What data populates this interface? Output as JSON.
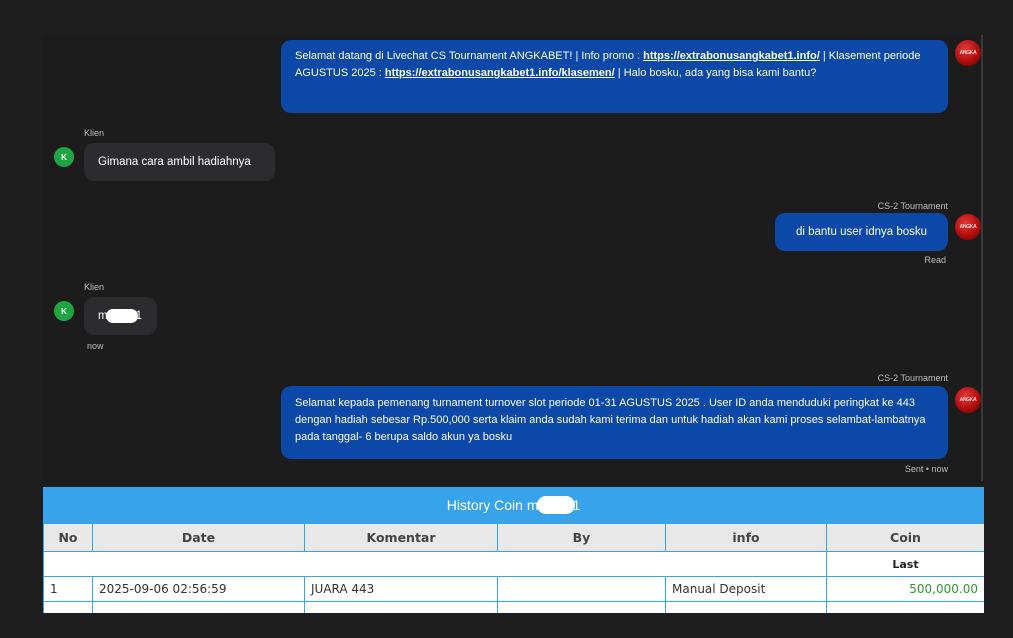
{
  "messages": {
    "m1": {
      "p1": "Selamat datang di Livechat CS Tournament ANGKABET! | Info promo : ",
      "link1": "https://extrabonusangkabet1.info/",
      "p2": " | Klasement periode AGUSTUS 2025 : ",
      "link2": "https://extrabonusangkabet1.info/klasemen/",
      "p3": " | Halo bosku, ada yang bisa kami bantu?"
    },
    "m2": {
      "sender": "Klien",
      "avatar": "K",
      "text": "Gimana cara ambil hadiahnya"
    },
    "m3": {
      "sender": "CS-2 Tournament",
      "text": "di bantu user idnya bosku",
      "status": "Read"
    },
    "m4": {
      "sender": "Klien",
      "avatar": "K",
      "text_start": "m",
      "text_end": "1",
      "time": "now"
    },
    "m5": {
      "sender": "CS-2 Tournament",
      "text": "Selamat kepada pemenang turnament turnover slot periode 01-31 AGUSTUS 2025 . User ID anda menduduki peringkat ke 443 dengan hadiah sebesar Rp.500,000 serta klaim anda sudah kami terima dan untuk hadiah akan kami proses selambat-lambatnya pada tanggal- 6 berupa saldo akun ya bosku",
      "status": "Sent • now"
    },
    "agent_avatar": "ANGKA"
  },
  "history": {
    "title_start": "History Coin m",
    "title_end": "1",
    "columns": [
      "No",
      "Date",
      "Komentar",
      "By",
      "info",
      "Coin"
    ],
    "subheader": "Last",
    "rows": [
      {
        "no": "1",
        "date": "2025-09-06 02:56:59",
        "komentar": "JUARA 443",
        "by": "",
        "info": "Manual Deposit",
        "coin": "500,000.00"
      }
    ]
  },
  "colors": {
    "agent_bubble": "#0b48a8",
    "client_bubble": "#2c2c2e",
    "client_avatar": "#1fa542",
    "table_header": "#36a3ea",
    "coin_value": "#2e9a34"
  }
}
